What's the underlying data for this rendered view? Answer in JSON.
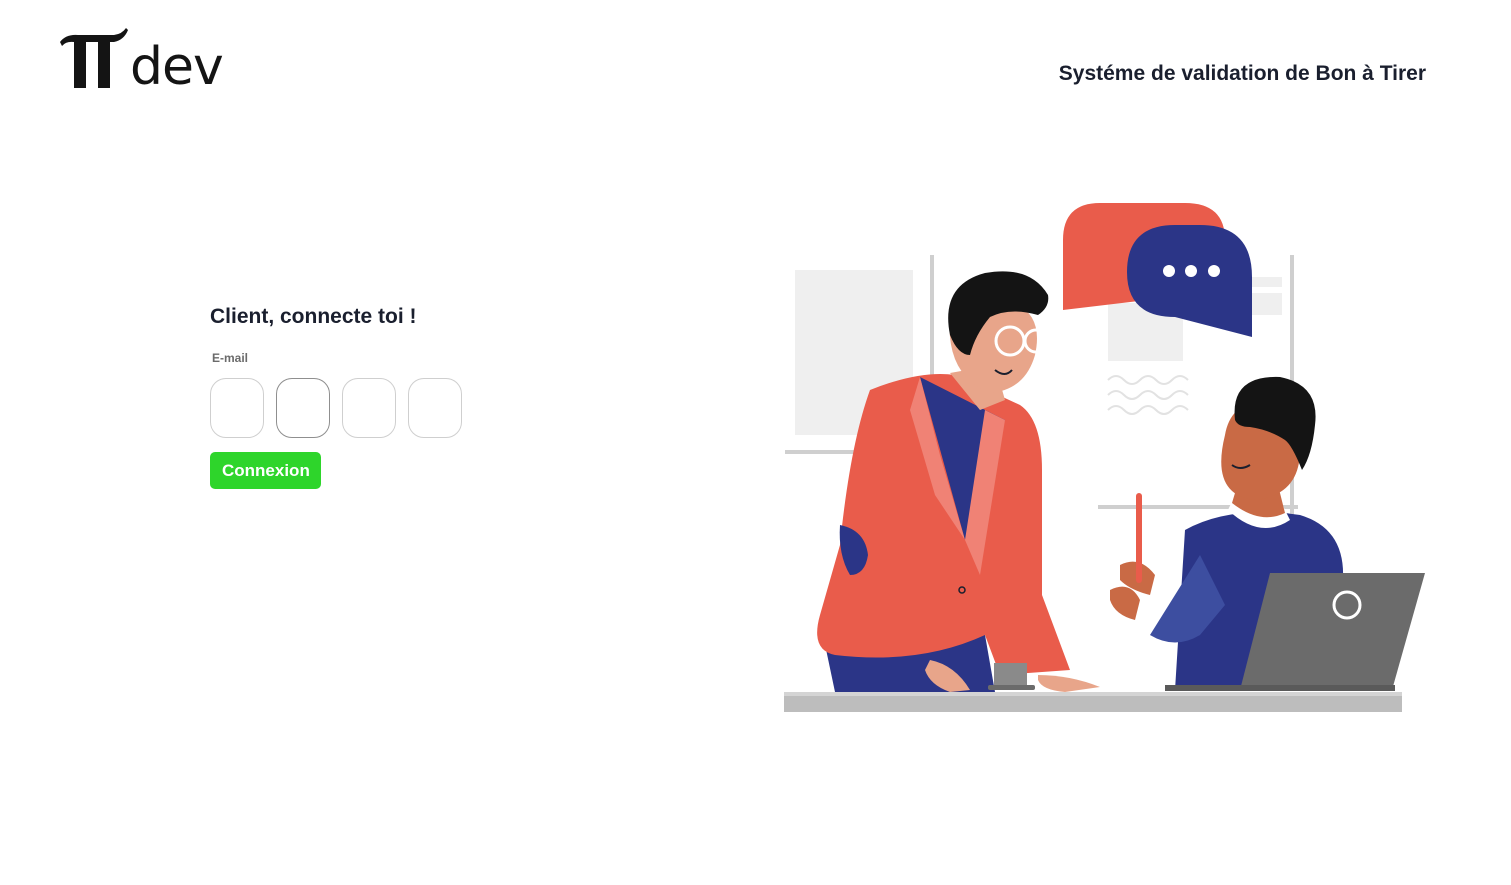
{
  "brand": {
    "logo_text": "dev"
  },
  "header": {
    "title": "Systéme de validation de Bon à Tirer"
  },
  "login": {
    "heading": "Client, connecte toi !",
    "email_label": "E-mail",
    "code_boxes": [
      "",
      "",
      "",
      ""
    ],
    "submit_label": "Connexion"
  },
  "colors": {
    "accent_green": "#2ed52b",
    "text_dark": "#1a1f2e",
    "illustration_red": "#e95c4b",
    "illustration_blue": "#2b3587"
  }
}
